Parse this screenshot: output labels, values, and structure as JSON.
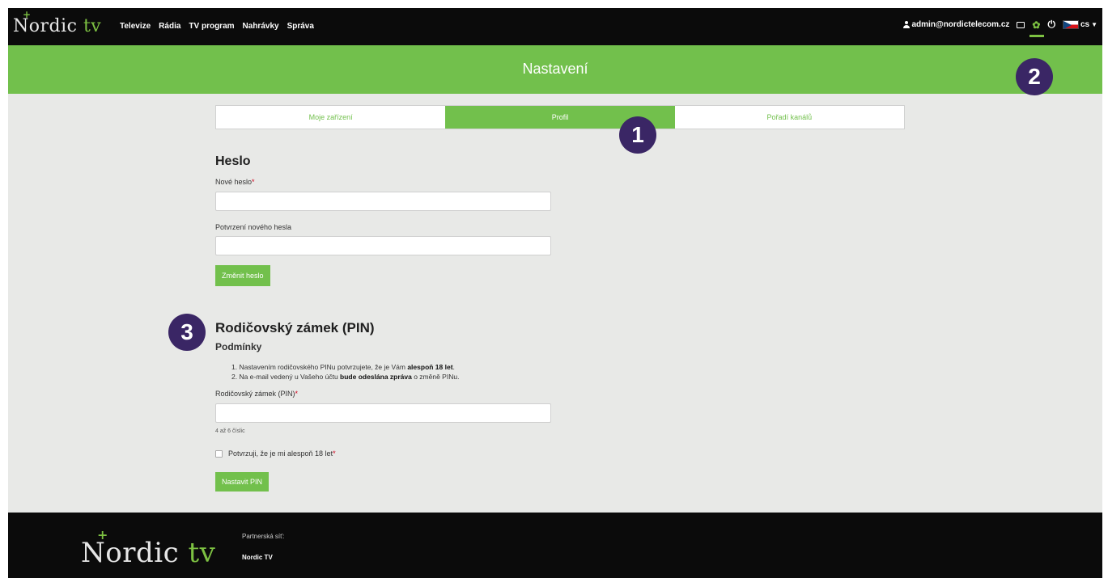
{
  "nav": {
    "logo_main": "Nordic",
    "logo_tv": "tv",
    "links": [
      "Televize",
      "Rádia",
      "TV program",
      "Nahrávky",
      "Správa"
    ],
    "user_email": "admin@nordictelecom.cz",
    "lang": "cs",
    "icons": [
      "user-icon",
      "mail-icon",
      "gear-icon",
      "power-icon",
      "czech-flag-icon"
    ]
  },
  "banner": {
    "title": "Nastavení"
  },
  "tabs": [
    {
      "label": "Moje zařízení",
      "active": false
    },
    {
      "label": "Profil",
      "active": true
    },
    {
      "label": "Pořadí kanálů",
      "active": false
    }
  ],
  "password": {
    "heading": "Heslo",
    "new_label": "Nové heslo",
    "confirm_label": "Potvrzení nového hesla",
    "button": "Změnit heslo"
  },
  "pin": {
    "heading": "Rodičovský zámek (PIN)",
    "subheading": "Podmínky",
    "cond1_pre": "1. Nastavením rodičovského PINu potvrzujete, že je Vám ",
    "cond1_bold": "alespoň 18 let",
    "cond1_post": ".",
    "cond2_pre": "2. Na e-mail vedený u Vašeho účtu ",
    "cond2_bold": "bude odeslána zpráva",
    "cond2_post": " o změně PINu.",
    "field_label": "Rodičovský zámek (PIN)",
    "hint": "4 až 6 číslic",
    "checkbox_label": "Potvrzuji, že je mi alespoň 18 let",
    "button": "Nastavit PIN"
  },
  "required_mark": "*",
  "badges": [
    "1",
    "2",
    "3"
  ],
  "footer": {
    "logo_main": "Nordic",
    "logo_tv": "tv",
    "partner_label": "Partnerská síť:",
    "partner_name": "Nordic TV"
  },
  "colors": {
    "accent": "#72c04c",
    "badge": "#3a2665",
    "dark": "#0b0b0b"
  }
}
